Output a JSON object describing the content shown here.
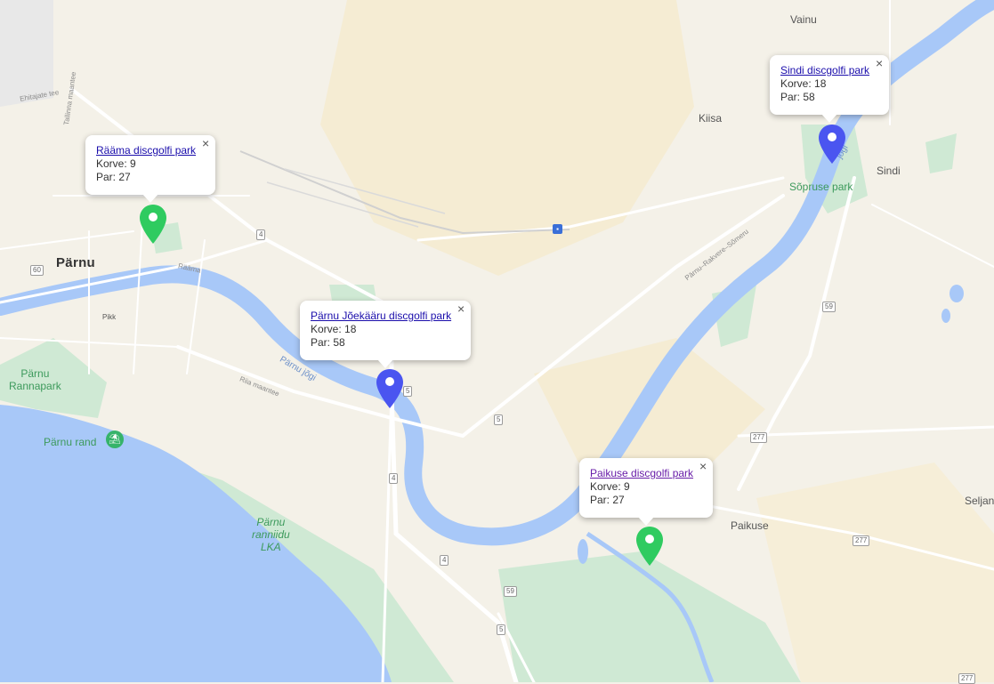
{
  "map": {
    "city": "Pärnu",
    "towns": [
      "Vainu",
      "Kiisa",
      "Sindi",
      "Paikuse",
      "Seljan",
      "Pikk"
    ],
    "parks": {
      "sopruse": "Sõpruse park",
      "rannapark": "Pärnu\nRannapark",
      "rand": "Pärnu rand",
      "lka": "Pärnu\nranniidu\nLKA"
    },
    "roads": {
      "tallinna": "Tallinna maantee",
      "ehitajate": "Ehitajate tee",
      "raama": "Rääma",
      "riia": "Riia maantee",
      "rakvere": "Pärnu–Rakvere–Sõmeru"
    },
    "rivers": {
      "parnu_jogi": "Pärnu jõgi",
      "upper": "jõgi"
    },
    "shields": [
      "4",
      "60",
      "5",
      "5",
      "4",
      "4",
      "59",
      "59",
      "277",
      "277",
      "277",
      "5"
    ]
  },
  "markers": [
    {
      "name": "Rääma discgolfi park",
      "korve": "Korve: 9",
      "par": "Par: 27",
      "color": "#2fcb60",
      "visited": false
    },
    {
      "name": "Pärnu Jõekääru discgolfi park",
      "korve": "Korve: 18",
      "par": "Par: 58",
      "color": "#4a55f0",
      "visited": false
    },
    {
      "name": "Sindi discgolfi park",
      "korve": "Korve: 18",
      "par": "Par: 58",
      "color": "#4a55f0",
      "visited": false
    },
    {
      "name": "Paikuse discgolfi park",
      "korve": "Korve: 9",
      "par": "Par: 27",
      "color": "#2fcb60",
      "visited": true
    }
  ],
  "colors": {
    "land": "#f4f1e8",
    "water": "#a8c8f8",
    "green": "#cfe9d4",
    "road": "#ffffff",
    "pin_green": "#2fcb60",
    "pin_blue": "#4a55f0"
  }
}
